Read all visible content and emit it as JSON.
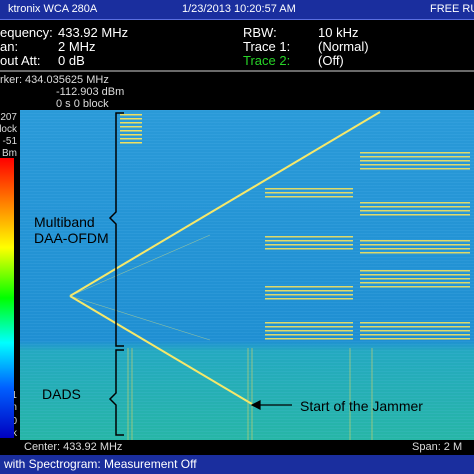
{
  "titlebar": {
    "brand": "ktronix WCA 280A",
    "datetime": "1/23/2013 10:20:57 AM",
    "mode": "FREE RU"
  },
  "settings": {
    "frequency_label": "equency:",
    "frequency_value": "433.92 MHz",
    "span_label": "an:",
    "span_value": "2 MHz",
    "input_att_label": "out Att:",
    "input_att_value": "0 dB",
    "rbw_label": "RBW:",
    "rbw_value": "10 kHz",
    "trace1_label": "Trace 1:",
    "trace1_value": "(Normal)",
    "trace2_label": "Trace 2:",
    "trace2_value": "(Off)"
  },
  "marker": {
    "line1": "rker: 434.035625 MHz",
    "line2": "-112.903 dBm",
    "line3": "0 s  0 block"
  },
  "left_scale": {
    "top1": "207",
    "top2": "lock",
    "top3": "-51",
    "top4": "Bm",
    "bot1": "151",
    "bot2": "Bm",
    "bot3": "0",
    "bot4": "lock"
  },
  "annotations": {
    "multiband_line1": "Multiband",
    "multiband_line2": "DAA-OFDM",
    "dads": "DADS",
    "jammer": "Start of the Jammer"
  },
  "footer": {
    "center": "Center: 433.92 MHz",
    "span": "Span: 2 M"
  },
  "status": {
    "text": "with Spectrogram: Measurement Off"
  },
  "colors": {
    "titlebar": "#1a2e9e",
    "background_noise": "#2a9ad8",
    "signal_trace": "#f0e060",
    "label_green": "#27d427"
  }
}
